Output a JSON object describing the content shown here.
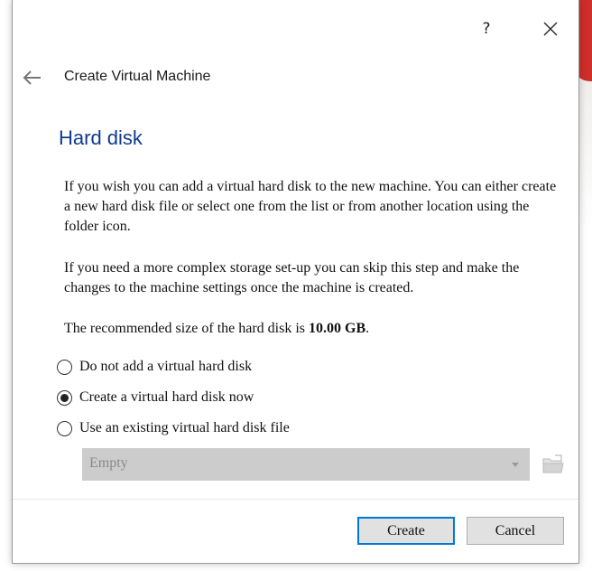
{
  "window": {
    "help_glyph": "?",
    "close_icon": "close-icon"
  },
  "header": {
    "back_icon": "back-arrow-icon",
    "title": "Create Virtual Machine"
  },
  "page": {
    "title": "Hard disk",
    "paragraph1": "If you wish you can add a virtual hard disk to the new machine. You can either create a new hard disk file or select one from the list or from another location using the folder icon.",
    "paragraph2": "If you need a more complex storage set-up you can skip this step and make the changes to the machine settings once the machine is created.",
    "recommended_prefix": "The recommended size of the hard disk is ",
    "recommended_size": "10.00 GB",
    "recommended_suffix": "."
  },
  "options": [
    {
      "label": "Do not add a virtual hard disk",
      "selected": false
    },
    {
      "label": "Create a virtual hard disk now",
      "selected": true
    },
    {
      "label": "Use an existing virtual hard disk file",
      "selected": false
    }
  ],
  "disk_select": {
    "value": "Empty",
    "enabled": false
  },
  "folder_button_icon": "folder-icon",
  "buttons": {
    "create": "Create",
    "cancel": "Cancel"
  },
  "colors": {
    "title_blue": "#0f3b8f",
    "focus_blue": "#0078d7",
    "disabled_gray": "#cccccc"
  }
}
